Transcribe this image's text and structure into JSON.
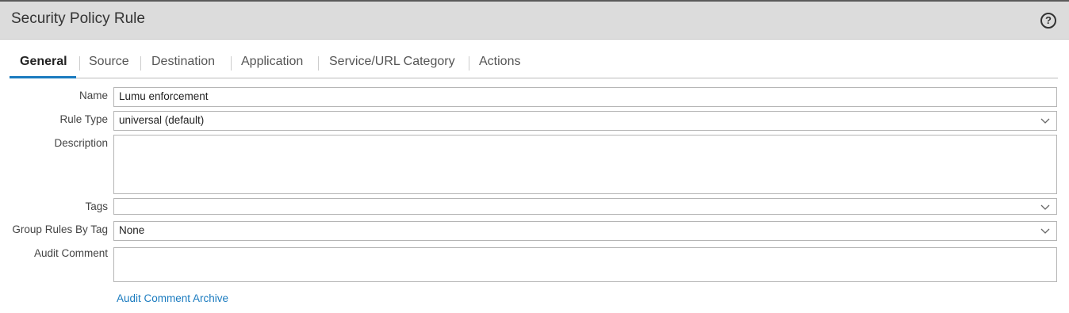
{
  "dialog": {
    "title": "Security Policy Rule",
    "help_icon": "question-circle-icon"
  },
  "tabs": [
    {
      "label": "General",
      "active": true
    },
    {
      "label": "Source"
    },
    {
      "label": "Destination"
    },
    {
      "label": "Application"
    },
    {
      "label": "Service/URL Category"
    },
    {
      "label": "Actions"
    }
  ],
  "form": {
    "name": {
      "label": "Name",
      "value": "Lumu enforcement"
    },
    "rule_type": {
      "label": "Rule Type",
      "value": "universal (default)"
    },
    "description": {
      "label": "Description",
      "value": ""
    },
    "tags": {
      "label": "Tags",
      "value": ""
    },
    "group_rules_by_tag": {
      "label": "Group Rules By Tag",
      "value": "None"
    },
    "audit_comment": {
      "label": "Audit Comment",
      "value": ""
    },
    "audit_comment_archive_link": "Audit Comment Archive"
  },
  "colors": {
    "accent": "#1a7bbf",
    "titlebar": "#dcdcdc"
  }
}
